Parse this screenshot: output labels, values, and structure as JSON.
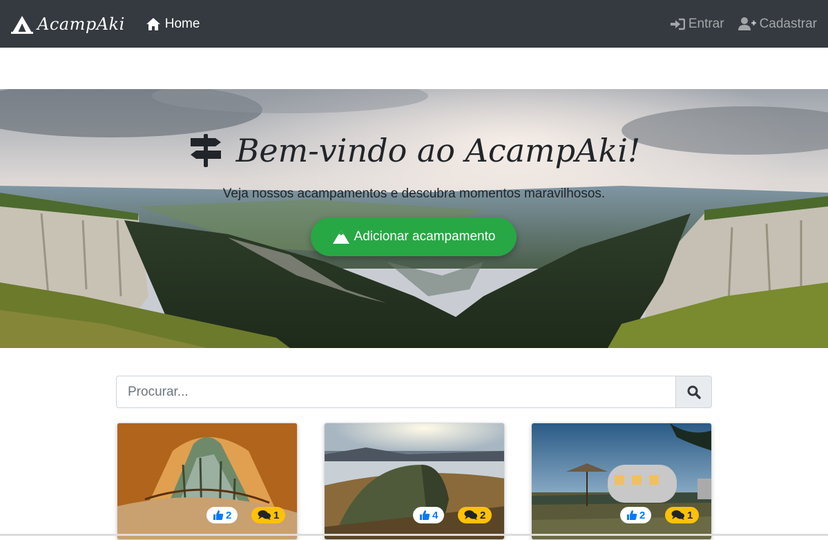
{
  "navbar": {
    "brand": "AcampAki",
    "brand_icon": "campground-icon",
    "home_label": "Home",
    "login_label": "Entrar",
    "signup_label": "Cadastrar"
  },
  "hero": {
    "title": "Bem-vindo ao AcampAki!",
    "subtitle": "Veja nossos acampamentos e descubra momentos maravilhosos.",
    "button_label": "Adicionar acampamento"
  },
  "search": {
    "placeholder": "Procurar..."
  },
  "cards": [
    {
      "likes": "2",
      "comments": "1"
    },
    {
      "likes": "4",
      "comments": "2"
    },
    {
      "likes": "2",
      "comments": "1"
    }
  ],
  "colors": {
    "navbar": "#343a40",
    "primary_button": "#28a745",
    "like_text": "#007bff",
    "comment_badge": "#ffc107"
  }
}
